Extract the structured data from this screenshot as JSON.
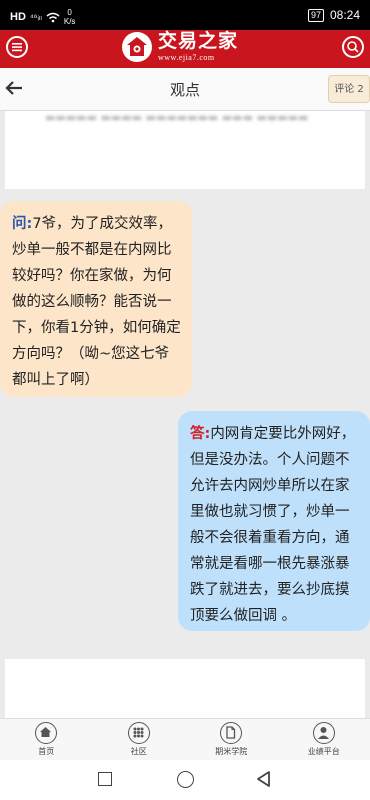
{
  "status_bar": {
    "network": "HD",
    "signal": "⁴⁶ᵢₗₗ",
    "speed_value": "0",
    "speed_unit": "K/s",
    "battery": "97",
    "time": "08:24"
  },
  "header": {
    "brand_name": "交易之家",
    "brand_url": "www.ejia7.com",
    "menu_icon": "hamburger-menu-icon",
    "search_icon": "search-icon",
    "accent_color": "#c9151e"
  },
  "nav": {
    "title": "观点",
    "comment_button": "评论 2",
    "back_icon": "back-arrow-icon"
  },
  "qa": {
    "question_prefix": "问:",
    "question_text": "7爷，为了成交效率，炒单一般不都是在内网比较好吗？你在家做，为何做的这么顺畅？能否说一下，你看1分钟，如何确定方向吗？（呦~您这七爷都叫上了啊）",
    "answer_prefix": "答:",
    "answer_text": "内网肯定要比外网好，但是没办法。个人问题不允许去内网炒单所以在家里做也就习惯了，炒单一般不会很着重看方向，通常就是看哪一根先暴涨暴跌了就进去，要么抄底摸顶要么做回调 。"
  },
  "tabbar": {
    "items": [
      {
        "label": "首页",
        "icon": "home-icon"
      },
      {
        "label": "社区",
        "icon": "community-grid-icon"
      },
      {
        "label": "期米学院",
        "icon": "academy-document-icon"
      },
      {
        "label": "业绩平台",
        "icon": "user-icon"
      }
    ]
  },
  "system_nav": {
    "recents_icon": "square-icon",
    "home_icon": "circle-icon",
    "back_icon": "triangle-back-icon"
  }
}
